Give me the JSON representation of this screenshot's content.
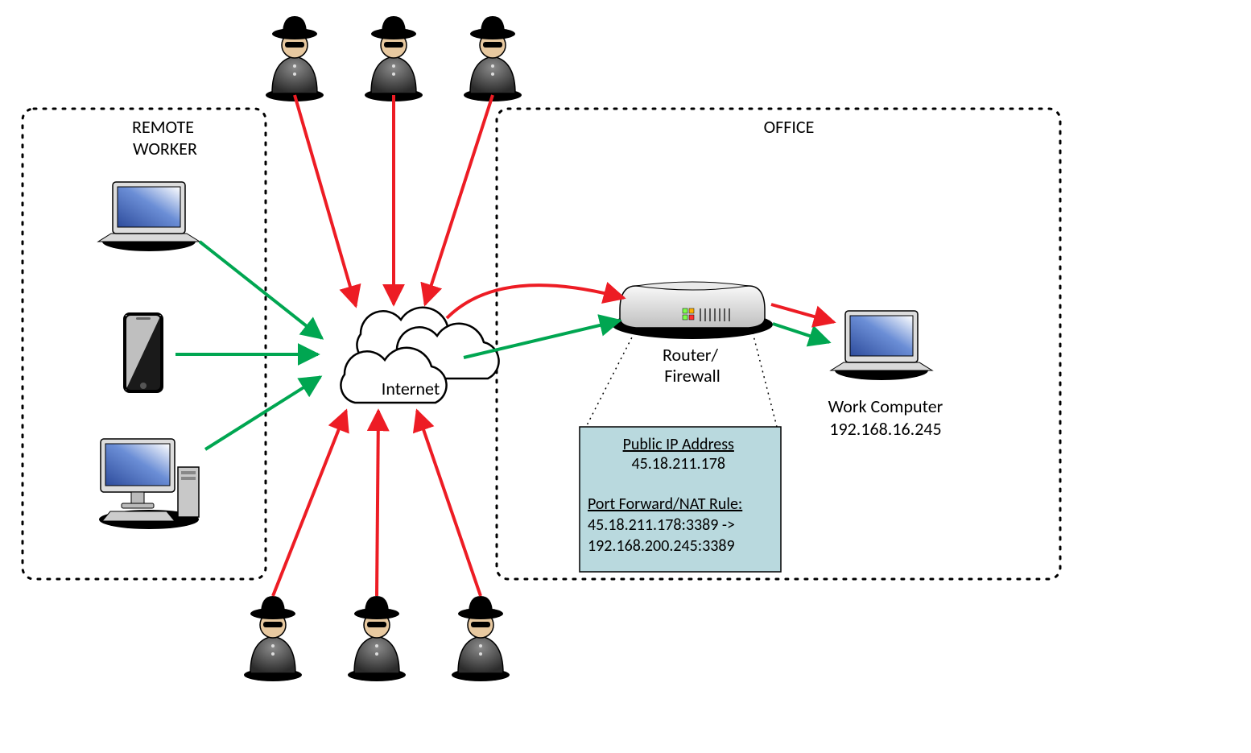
{
  "labels": {
    "remote_box": "REMOTE\nWORKER",
    "office_box": "OFFICE",
    "internet": "Internet",
    "router": "Router/\nFirewall",
    "work_computer_name": "Work Computer",
    "work_computer_ip": "192.168.16.245"
  },
  "router_detail": {
    "public_ip_heading": "Public IP Address",
    "public_ip_value": "45.18.211.178",
    "nat_heading": "Port Forward/NAT Rule:",
    "nat_line1": "45.18.211.178:3389 ->",
    "nat_line2": "192.168.200.245:3389"
  },
  "colors": {
    "attack_arrow": "#ED1C24",
    "legit_arrow": "#00A651",
    "box_fill": "#B9D9DE",
    "box_stroke": "#000000"
  }
}
